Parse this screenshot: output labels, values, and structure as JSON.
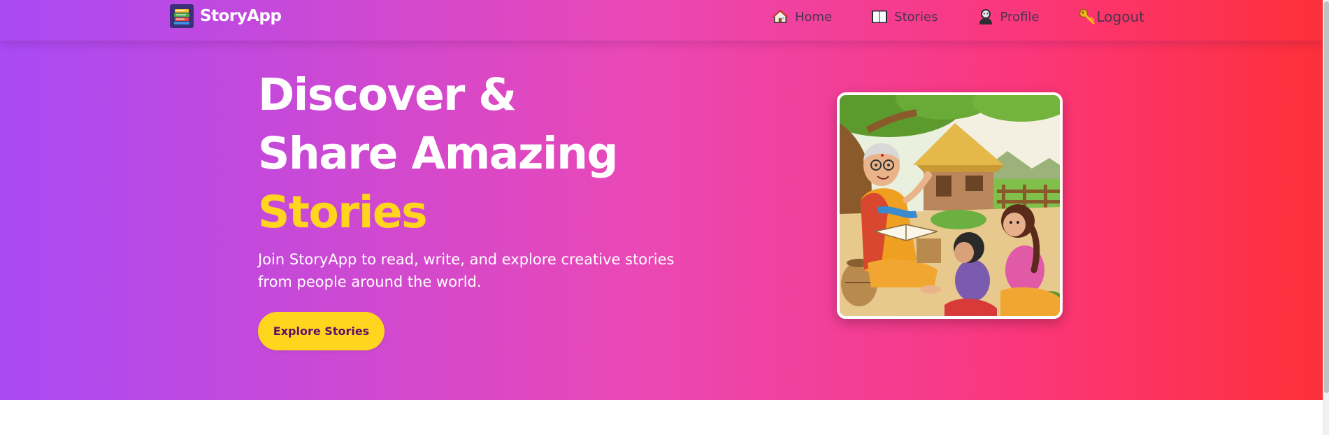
{
  "brand": {
    "name": "StoryApp",
    "logo_icon": "stacked-books-icon"
  },
  "nav": {
    "items": [
      {
        "label": "Home",
        "icon": "house-icon"
      },
      {
        "label": "Stories",
        "icon": "open-book-icon"
      },
      {
        "label": "Profile",
        "icon": "person-icon"
      },
      {
        "label": "Logout",
        "icon": "key-icon"
      }
    ]
  },
  "hero": {
    "title_line1": "Discover &",
    "title_line2": "Share Amazing",
    "title_accent": "Stories",
    "subtitle": "Join StoryApp to read, write, and explore creative stories from people around the world.",
    "cta_label": "Explore Stories",
    "image_description_icon": "grandmother-storytelling-illustration"
  },
  "colors": {
    "gradient_start": "#a94af5",
    "gradient_mid": "#ea48b6",
    "gradient_end": "#fd2f38",
    "accent_yellow": "#ffd51e",
    "cta_text": "#5b1069"
  }
}
